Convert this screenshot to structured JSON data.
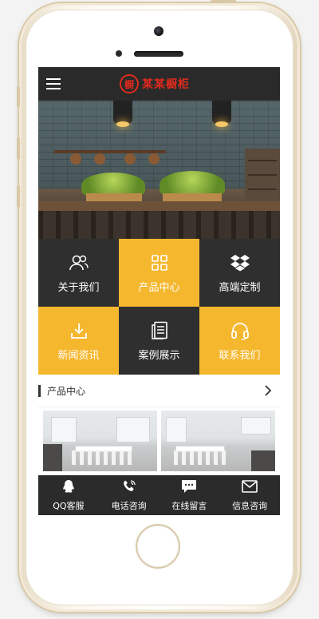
{
  "header": {
    "menu_icon": "hamburger-menu-icon",
    "logo_char": "橱",
    "logo_text": "某某橱柜",
    "accent": "#e02a1e"
  },
  "banner": {
    "image": "kitchen-interior-photo"
  },
  "grid": {
    "items": [
      {
        "label": "关于我们",
        "icon": "users-icon",
        "bg": "#2f2f2f"
      },
      {
        "label": "产品中心",
        "icon": "grid-icon",
        "bg": "#f5b72e"
      },
      {
        "label": "高端定制",
        "icon": "dropbox-icon",
        "bg": "#2f2f2f"
      },
      {
        "label": "新闻资讯",
        "icon": "download-icon",
        "bg": "#f5b72e"
      },
      {
        "label": "案例展示",
        "icon": "document-icon",
        "bg": "#2f2f2f"
      },
      {
        "label": "联系我们",
        "icon": "headset-icon",
        "bg": "#f5b72e"
      }
    ]
  },
  "products_section": {
    "title": "产品中心",
    "arrow_icon": "chevron-right-icon"
  },
  "products": [
    {
      "image": "dining-room-photo"
    },
    {
      "image": "kitchen-dining-photo"
    }
  ],
  "tabbar": {
    "items": [
      {
        "label": "QQ客服",
        "icon": "qq-icon"
      },
      {
        "label": "电话咨询",
        "icon": "phone-icon"
      },
      {
        "label": "在线留言",
        "icon": "chat-icon"
      },
      {
        "label": "信息咨询",
        "icon": "mail-icon"
      }
    ]
  }
}
